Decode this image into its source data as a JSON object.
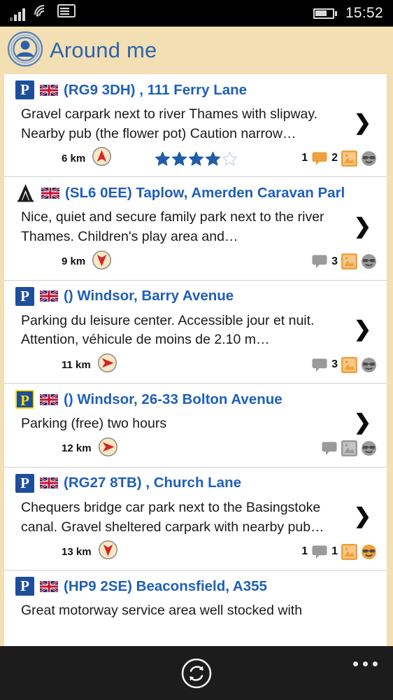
{
  "status_bar": {
    "signal_icon": "signal-bars-icon",
    "wifi_icon": "wifi-icon",
    "sim_icon": "sim-card-icon",
    "battery_icon": "battery-icon",
    "battery_level_pct": 68,
    "time": "15:52"
  },
  "header": {
    "app_icon": "around-me-person-radar-icon",
    "title": "Around me"
  },
  "colors": {
    "page_background": "#f2dfb3",
    "title_blue": "#1f5fb8",
    "badge_blue": "#1c4e9c",
    "accent_orange": "#eda13c",
    "inactive_gray": "#9a9a9a",
    "star_blue": "#215ca8",
    "arrow_red": "#d8232a"
  },
  "list": {
    "items": [
      {
        "category_icon": "parking-badge-icon",
        "category_style": "blue",
        "flag_icon": "uk-flag-icon",
        "title": "(RG9 3DH) , 111 Ferry Lane",
        "description": "Gravel carpark next to river Thames with slipway. Nearby pub (the flower pot)  Caution narrow…",
        "distance": "6 km",
        "direction_icon": "arrow-up-icon",
        "rating": 4,
        "rating_max": 5,
        "comment_count": "1",
        "comment_active": true,
        "photo_count": "2",
        "photo_active": true,
        "mood_active": false,
        "mood_count": "",
        "chevron_icon": "chevron-right-icon"
      },
      {
        "category_icon": "camping-tent-icon",
        "category_style": "tent",
        "flag_icon": "uk-flag-icon",
        "title": "(SL6 0EE) Taplow,  Amerden Caravan Parl",
        "description": "Nice, quiet and secure family park next to the river Thames. Children's play area and…",
        "distance": "9 km",
        "direction_icon": "arrow-down-icon",
        "rating": 0,
        "rating_max": 5,
        "comment_count": "",
        "comment_active": false,
        "photo_count": "3",
        "photo_active": true,
        "mood_active": false,
        "mood_count": "",
        "chevron_icon": "chevron-right-icon"
      },
      {
        "category_icon": "parking-badge-icon",
        "category_style": "blue",
        "flag_icon": "uk-flag-icon",
        "title": "() Windsor,  Barry Avenue",
        "description": "Parking du leisure center. Accessible jour et nuit. Attention, véhicule de moins de 2.10 m…",
        "distance": "11 km",
        "direction_icon": "arrow-right-icon",
        "rating": 0,
        "rating_max": 5,
        "comment_count": "",
        "comment_active": false,
        "photo_count": "3",
        "photo_active": true,
        "mood_active": false,
        "mood_count": "",
        "chevron_icon": "chevron-right-icon"
      },
      {
        "category_icon": "parking-badge-icon",
        "category_style": "yellow",
        "flag_icon": "uk-flag-icon",
        "title": "() Windsor, 26-33 Bolton Avenue",
        "description": "Parking (free) two hours",
        "distance": "12 km",
        "direction_icon": "arrow-right-icon",
        "rating": 0,
        "rating_max": 5,
        "comment_count": "",
        "comment_active": false,
        "photo_count": "",
        "photo_active": false,
        "mood_active": false,
        "mood_count": "",
        "chevron_icon": "chevron-right-icon"
      },
      {
        "category_icon": "parking-badge-icon",
        "category_style": "blue",
        "flag_icon": "uk-flag-icon",
        "title": "(RG27 8TB) ,  Church Lane",
        "description": "Chequers bridge car park next to the Basingstoke canal. Gravel sheltered carpark with nearby pub…",
        "distance": "13 km",
        "direction_icon": "arrow-down-icon",
        "rating": 0,
        "rating_max": 5,
        "comment_count": "1",
        "comment_active": false,
        "photo_count": "1",
        "photo_active": true,
        "mood_active": true,
        "mood_count": "",
        "chevron_icon": "chevron-right-icon"
      },
      {
        "category_icon": "parking-badge-icon",
        "category_style": "blue",
        "flag_icon": "uk-flag-icon",
        "title": "(HP9 2SE) Beaconsfield,  A355",
        "description": "Great motorway service area well stocked with",
        "distance": "",
        "direction_icon": "",
        "rating": 0,
        "rating_max": 5,
        "comment_count": "",
        "comment_active": false,
        "photo_count": "",
        "photo_active": false,
        "mood_active": false,
        "mood_count": "",
        "chevron_icon": ""
      }
    ]
  },
  "bottom_bar": {
    "refresh_icon": "refresh-sync-icon",
    "more_icon": "more-ellipsis-icon"
  }
}
